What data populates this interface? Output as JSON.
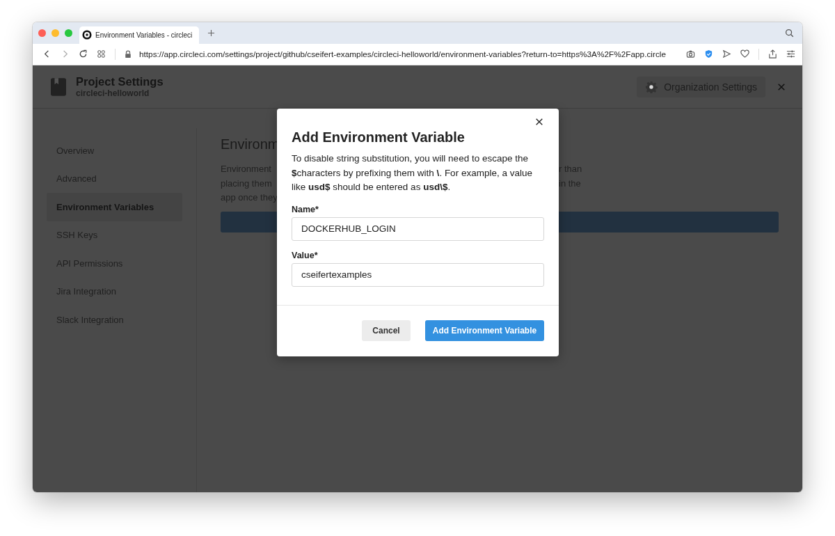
{
  "browser": {
    "tab_title": "Environment Variables - circleci",
    "url": "https://app.circleci.com/settings/project/github/cseifert-examples/circleci-helloworld/environment-variables?return-to=https%3A%2F%2Fapp.circle"
  },
  "header": {
    "title": "Project Settings",
    "subtitle": "circleci-helloworld",
    "org_button": "Organization Settings"
  },
  "sidebar": {
    "items": [
      {
        "label": "Overview",
        "selected": false
      },
      {
        "label": "Advanced",
        "selected": false
      },
      {
        "label": "Environment Variables",
        "selected": true
      },
      {
        "label": "SSH Keys",
        "selected": false
      },
      {
        "label": "API Permissions",
        "selected": false
      },
      {
        "label": "Jira Integration",
        "selected": false
      },
      {
        "label": "Slack Integration",
        "selected": false
      }
    ]
  },
  "content": {
    "heading": "Environm",
    "paragraph_lines": [
      {
        "left": "Environment",
        "right": "r than"
      },
      {
        "left": "placing them",
        "right": "in the"
      },
      {
        "left": "app once they"
      }
    ]
  },
  "modal": {
    "title": "Add Environment Variable",
    "description": "To disable string substitution, you will need to escape the **$**characters by prefixing them with **\\**. For example, a value like **usd$** should be entered as **usd\\$**.",
    "fields": [
      {
        "label": "Name*",
        "value": "DOCKERHUB_LOGIN"
      },
      {
        "label": "Value*",
        "value": "cseifertexamples"
      }
    ],
    "buttons": [
      {
        "label": "Cancel",
        "kind": "secondary"
      },
      {
        "label": "Add Environment Variable",
        "kind": "primary"
      }
    ]
  }
}
